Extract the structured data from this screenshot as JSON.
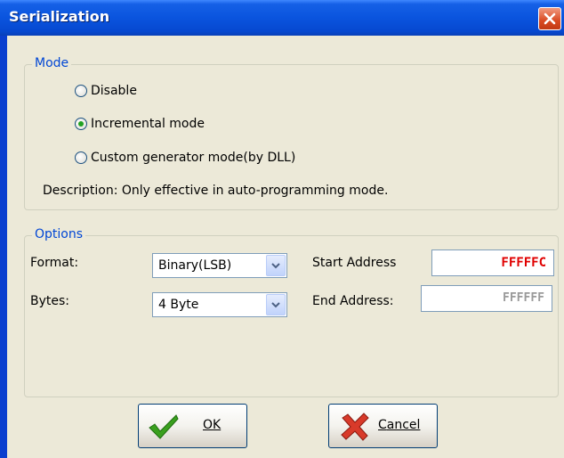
{
  "window": {
    "title": "Serialization"
  },
  "mode_group": {
    "legend": "Mode",
    "options": [
      {
        "label": "Disable",
        "checked": false
      },
      {
        "label": "Incremental mode",
        "checked": true
      },
      {
        "label": "Custom generator mode(by DLL)",
        "checked": false
      }
    ],
    "description": "Description: Only effective in auto-programming mode."
  },
  "options_group": {
    "legend": "Options",
    "format": {
      "label": "Format:",
      "value": "Binary(LSB)"
    },
    "bytes": {
      "label": "Bytes:",
      "value": "4 Byte"
    },
    "start_address": {
      "label": "Start Address",
      "value": "FFFFFC",
      "color": "#e00000"
    },
    "end_address": {
      "label": "End Address:",
      "value": "FFFFFF",
      "color": "#9a9a9a"
    }
  },
  "buttons": {
    "ok": {
      "mnemonic": "O",
      "rest": "K"
    },
    "cancel": {
      "mnemonic": "C",
      "rest": "ancel"
    }
  },
  "colors": {
    "title_bar": "#0a54de",
    "dialog_bg": "#ece9d8",
    "group_legend": "#0046d5",
    "ok_check": "#3aa01e",
    "cancel_x": "#d83a2a"
  },
  "icons": {
    "close": "close-icon",
    "ok": "checkmark-icon",
    "cancel": "x-cross-icon",
    "dropdown": "chevron-down-icon"
  }
}
